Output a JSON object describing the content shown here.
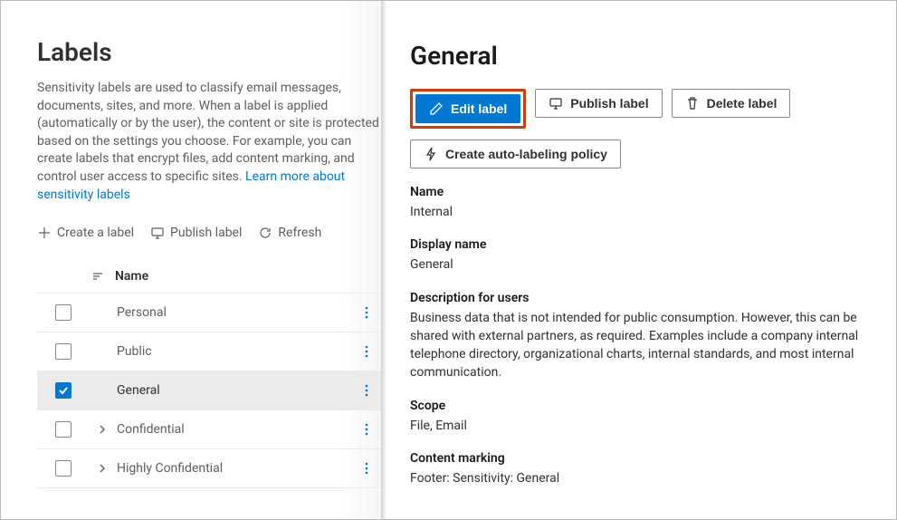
{
  "page": {
    "title": "Labels",
    "description": "Sensitivity labels are used to classify email messages, documents, sites, and more. When a label is applied (automatically or by the user), the content or site is protected based on the settings you choose. For example, you can create labels that encrypt files, add content marking, and control user access to specific sites.",
    "learn_link": "Learn more about sensitivity labels"
  },
  "commands": {
    "create": "Create a label",
    "publish": "Publish label",
    "refresh": "Refresh"
  },
  "table": {
    "col_name": "Name",
    "rows": [
      {
        "name": "Personal",
        "expandable": false,
        "selected": false
      },
      {
        "name": "Public",
        "expandable": false,
        "selected": false
      },
      {
        "name": "General",
        "expandable": false,
        "selected": true
      },
      {
        "name": "Confidential",
        "expandable": true,
        "selected": false
      },
      {
        "name": "Highly Confidential",
        "expandable": true,
        "selected": false
      }
    ]
  },
  "panel": {
    "title": "General",
    "buttons": {
      "edit": "Edit label",
      "publish": "Publish label",
      "delete": "Delete label",
      "auto": "Create auto-labeling policy"
    },
    "fields": {
      "name_label": "Name",
      "name_value": "Internal",
      "display_label": "Display name",
      "display_value": "General",
      "desc_label": "Description for users",
      "desc_value": "Business data that is not intended for public consumption. However, this can be shared with external partners, as required. Examples include a company internal telephone directory, organizational charts, internal standards, and most internal communication.",
      "scope_label": "Scope",
      "scope_value": "File, Email",
      "marking_label": "Content marking",
      "marking_value": "Footer: Sensitivity: General"
    }
  }
}
